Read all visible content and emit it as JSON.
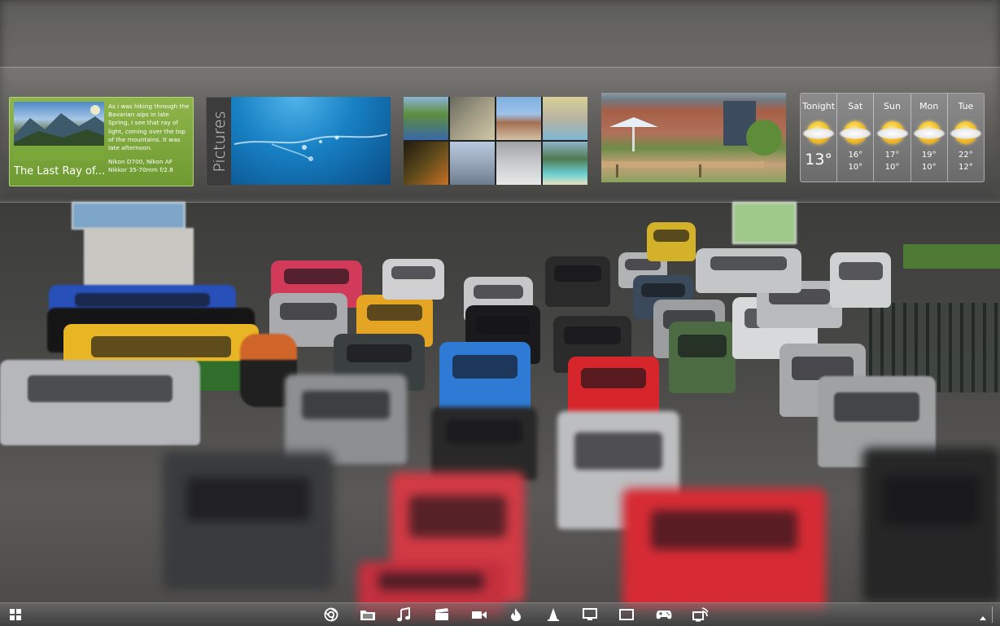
{
  "photo_widget": {
    "title": "The Last Ray of...",
    "description": "As i was hiking through the Bavarian alps in late Spring, I see that ray of light, coming over the top of the mountains. It was late afternoon.",
    "camera_line1": "Nikon D700, Nikon AF",
    "camera_line2": "Nikkor 35-70mm f/2.8"
  },
  "pictures_widget": {
    "label": "Pictures"
  },
  "weather_widget": {
    "days": [
      {
        "name": "Tonight",
        "temp": "13°",
        "icon": "partly-sunny-icon"
      },
      {
        "name": "Sat",
        "high": "16°",
        "low": "10°",
        "icon": "partly-sunny-icon"
      },
      {
        "name": "Sun",
        "high": "17°",
        "low": "10°",
        "icon": "partly-sunny-icon"
      },
      {
        "name": "Mon",
        "high": "19°",
        "low": "10°",
        "icon": "partly-sunny-icon"
      },
      {
        "name": "Tue",
        "high": "22°",
        "low": "12°",
        "icon": "partly-sunny-icon"
      }
    ]
  },
  "taskbar": {
    "start_icon": "windows-start-icon",
    "apps": [
      {
        "name": "browser",
        "icon": "globe-icon"
      },
      {
        "name": "files",
        "icon": "folder-icon"
      },
      {
        "name": "music",
        "icon": "music-note-icon"
      },
      {
        "name": "movies",
        "icon": "clapperboard-icon"
      },
      {
        "name": "video",
        "icon": "video-camera-icon"
      },
      {
        "name": "burn",
        "icon": "flame-icon"
      },
      {
        "name": "vlc",
        "icon": "cone-icon"
      },
      {
        "name": "display",
        "icon": "monitor-icon"
      },
      {
        "name": "window",
        "icon": "window-icon"
      },
      {
        "name": "games",
        "icon": "gamepad-icon"
      },
      {
        "name": "network",
        "icon": "network-icon"
      }
    ],
    "tray_icon": "chevron-up-icon"
  },
  "colors": {
    "photo_tile": "#7ea73c",
    "weather_tile": "#7a7a7a",
    "pictures_blue": "#1780c3"
  }
}
